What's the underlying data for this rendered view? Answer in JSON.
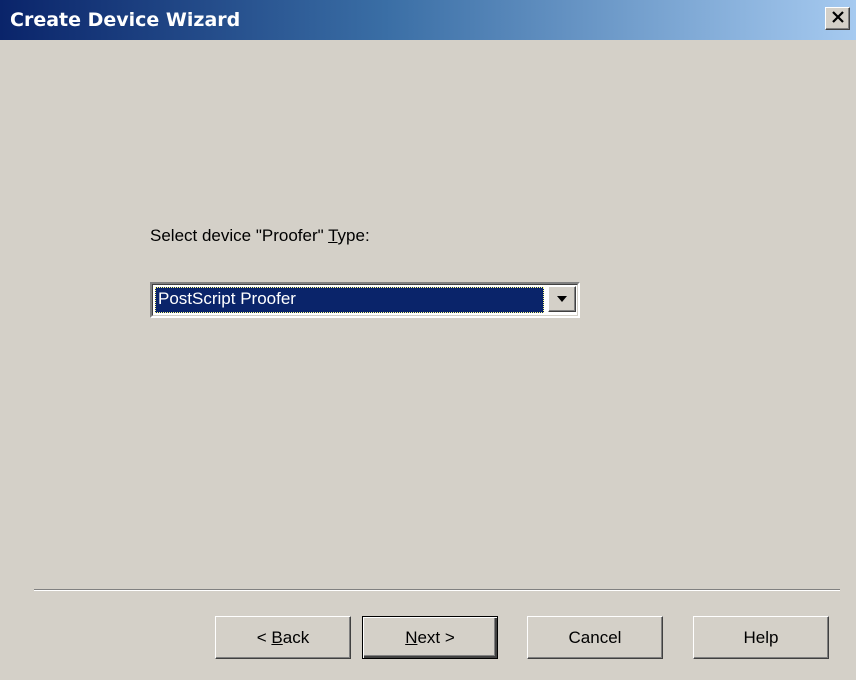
{
  "window": {
    "title": "Create Device Wizard"
  },
  "icons": {
    "close": "close-icon",
    "dropdown": "chevron-down-icon"
  },
  "colors": {
    "title_start": "#0a246a",
    "title_end": "#a6caf0",
    "face": "#d4d0c8",
    "selection": "#0a246a"
  },
  "prompt": {
    "prefix": "Select device \"Proofer\" ",
    "accel": "T",
    "suffix": "ype:"
  },
  "device_type": {
    "selected": "PostScript Proofer"
  },
  "buttons": {
    "back": {
      "prefix": "< ",
      "accel": "B",
      "suffix": "ack"
    },
    "next": {
      "accel": "N",
      "suffix": "ext >"
    },
    "cancel": "Cancel",
    "help": "Help"
  }
}
